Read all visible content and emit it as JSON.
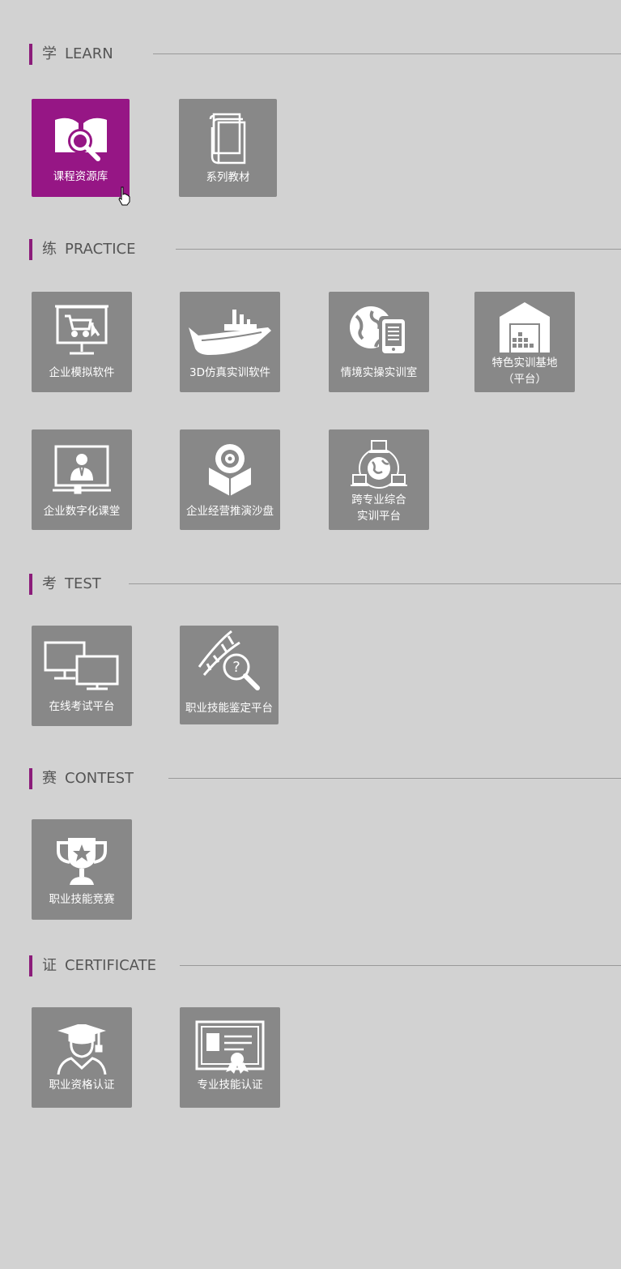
{
  "sections": {
    "learn": {
      "zh": "学",
      "en": "LEARN"
    },
    "practice": {
      "zh": "练",
      "en": "PRACTICE"
    },
    "test": {
      "zh": "考",
      "en": "TEST"
    },
    "contest": {
      "zh": "赛",
      "en": "CONTEST"
    },
    "certificate": {
      "zh": "证",
      "en": "CERTIFICATE"
    }
  },
  "tiles": {
    "course_library": {
      "label": "课程资源库",
      "icon": "book-search-icon"
    },
    "textbooks": {
      "label": "系列教材",
      "icon": "books-icon"
    },
    "enterprise_sim": {
      "label": "企业模拟软件",
      "icon": "shopping-cart-screen-icon"
    },
    "sim_3d": {
      "label": "3D仿真实训软件",
      "icon": "ship-icon"
    },
    "scenario_lab": {
      "label": "情境实操实训室",
      "icon": "globe-tablet-icon"
    },
    "feature_base": {
      "line1": "特色实训基地",
      "line2": "（平台）",
      "icon": "warehouse-icon"
    },
    "digital_classroom": {
      "label": "企业数字化课堂",
      "icon": "teacher-screen-icon"
    },
    "sandbox": {
      "label": "企业经营推演沙盘",
      "icon": "disc-box-icon"
    },
    "cross_discipline": {
      "line1": "跨专业综合",
      "line2": "实训平台",
      "icon": "globe-network-icon"
    },
    "online_exam": {
      "label": "在线考试平台",
      "icon": "monitors-icon"
    },
    "skill_appraisal": {
      "label": "职业技能鉴定平台",
      "icon": "dna-search-icon"
    },
    "skill_contest": {
      "label": "职业技能竞赛",
      "icon": "trophy-icon"
    },
    "qualification": {
      "label": "职业资格认证",
      "icon": "graduate-icon"
    },
    "pro_skill_cert": {
      "label": "专业技能认证",
      "icon": "certificate-icon"
    }
  },
  "colors": {
    "background": "#d2d2d2",
    "tile": "#888888",
    "active_tile": "#961685",
    "accent_bar": "#8b1c7a"
  }
}
